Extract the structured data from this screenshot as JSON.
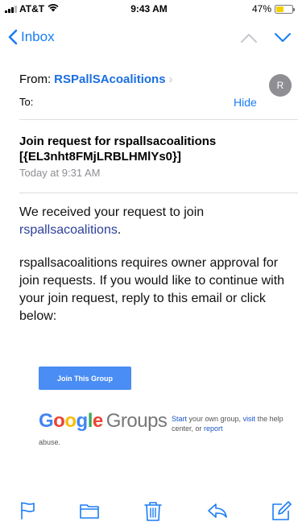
{
  "status_bar": {
    "carrier": "AT&T",
    "time": "9:43 AM",
    "battery_percent": "47%",
    "battery_level": 0.47,
    "signal_bars": 3
  },
  "nav": {
    "back_label": "Inbox",
    "prev_icon": "chevron-up-icon",
    "next_icon": "chevron-down-icon"
  },
  "header": {
    "from_label": "From:",
    "from_name": "RSPallSAcoalitions",
    "avatar_initial": "R",
    "to_label": "To:",
    "hide_label": "Hide",
    "subject": "Join request for rspallsacoalitions [{EL3nht8FMjLRBLHMlYs0}]",
    "date": "Today at 9:31 AM"
  },
  "message": {
    "para1_text": "We received your request to join",
    "group_link": "rspallsacoalitions",
    "para1_end": ".",
    "para2": "rspallsacoalitions requires owner approval for join requests. If you would like to continue with your join request, reply to this email or click below:",
    "join_button": "Join This Group",
    "footer_start": "Start",
    "footer_mid": " your own group, ",
    "footer_visit": "visit",
    "footer_mid2": " the help center, or ",
    "footer_report": "report",
    "footer_abuse": "abuse."
  },
  "brand": {
    "google_g": "G",
    "google_o1": "o",
    "google_o2": "o",
    "google_g2": "g",
    "google_l": "l",
    "google_e": "e",
    "groups_word": "Groups"
  },
  "toolbar": {
    "items": [
      "flag-icon",
      "folder-icon",
      "trash-icon",
      "reply-icon",
      "compose-icon"
    ]
  },
  "colors": {
    "accent": "#1a7cf5",
    "button": "#4a8df4",
    "battery": "#f5d000"
  }
}
